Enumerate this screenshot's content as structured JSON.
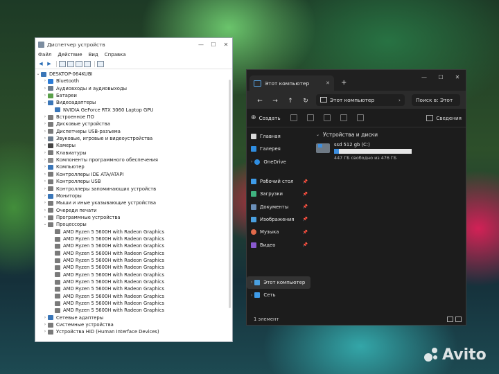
{
  "device_manager": {
    "title": "Диспетчер устройств",
    "menu": [
      "Файл",
      "Действие",
      "Вид",
      "Справка"
    ],
    "computer": "DESKTOP-064KUBI",
    "tree": [
      {
        "label": "Bluetooth",
        "color": "#2b7bd6",
        "expanded": false,
        "level": 1
      },
      {
        "label": "Аудиовходы и аудиовыходы",
        "color": "#6b7b8c",
        "expanded": false,
        "level": 1
      },
      {
        "label": "Батареи",
        "color": "#5aa04a",
        "expanded": false,
        "level": 1
      },
      {
        "label": "Видеоадаптеры",
        "color": "#3a76b8",
        "expanded": true,
        "level": 1
      },
      {
        "label": "NVIDIA GeForce RTX 3060 Laptop GPU",
        "color": "#3a76b8",
        "expanded": null,
        "level": 2
      },
      {
        "label": "Встроенное ПО",
        "color": "#7a7a7a",
        "expanded": false,
        "level": 1
      },
      {
        "label": "Дисковые устройства",
        "color": "#7a7a7a",
        "expanded": false,
        "level": 1
      },
      {
        "label": "Диспетчеры USB-разъема",
        "color": "#7a7a7a",
        "expanded": false,
        "level": 1
      },
      {
        "label": "Звуковые, игровые и видеоустройства",
        "color": "#6b7b8c",
        "expanded": false,
        "level": 1
      },
      {
        "label": "Камеры",
        "color": "#444444",
        "expanded": false,
        "level": 1
      },
      {
        "label": "Клавиатуры",
        "color": "#7a7a7a",
        "expanded": false,
        "level": 1
      },
      {
        "label": "Компоненты программного обеспечения",
        "color": "#8a8a8a",
        "expanded": false,
        "level": 1
      },
      {
        "label": "Компьютер",
        "color": "#3a76b8",
        "expanded": false,
        "level": 1
      },
      {
        "label": "Контроллеры IDE ATA/ATAPI",
        "color": "#7a7a7a",
        "expanded": false,
        "level": 1
      },
      {
        "label": "Контроллеры USB",
        "color": "#7a7a7a",
        "expanded": false,
        "level": 1
      },
      {
        "label": "Контроллеры запоминающих устройств",
        "color": "#7a7a7a",
        "expanded": false,
        "level": 1
      },
      {
        "label": "Мониторы",
        "color": "#3a76b8",
        "expanded": false,
        "level": 1
      },
      {
        "label": "Мыши и иные указывающие устройства",
        "color": "#7a7a7a",
        "expanded": false,
        "level": 1
      },
      {
        "label": "Очереди печати",
        "color": "#7a7a7a",
        "expanded": false,
        "level": 1
      },
      {
        "label": "Программные устройства",
        "color": "#7a7a7a",
        "expanded": false,
        "level": 1
      },
      {
        "label": "Процессоры",
        "color": "#7a7a7a",
        "expanded": true,
        "level": 1
      },
      {
        "label": "AMD Ryzen 5 5600H with Radeon Graphics",
        "color": "#7a7a7a",
        "expanded": null,
        "level": 2
      },
      {
        "label": "AMD Ryzen 5 5600H with Radeon Graphics",
        "color": "#7a7a7a",
        "expanded": null,
        "level": 2
      },
      {
        "label": "AMD Ryzen 5 5600H with Radeon Graphics",
        "color": "#7a7a7a",
        "expanded": null,
        "level": 2
      },
      {
        "label": "AMD Ryzen 5 5600H with Radeon Graphics",
        "color": "#7a7a7a",
        "expanded": null,
        "level": 2
      },
      {
        "label": "AMD Ryzen 5 5600H with Radeon Graphics",
        "color": "#7a7a7a",
        "expanded": null,
        "level": 2
      },
      {
        "label": "AMD Ryzen 5 5600H with Radeon Graphics",
        "color": "#7a7a7a",
        "expanded": null,
        "level": 2
      },
      {
        "label": "AMD Ryzen 5 5600H with Radeon Graphics",
        "color": "#7a7a7a",
        "expanded": null,
        "level": 2
      },
      {
        "label": "AMD Ryzen 5 5600H with Radeon Graphics",
        "color": "#7a7a7a",
        "expanded": null,
        "level": 2
      },
      {
        "label": "AMD Ryzen 5 5600H with Radeon Graphics",
        "color": "#7a7a7a",
        "expanded": null,
        "level": 2
      },
      {
        "label": "AMD Ryzen 5 5600H with Radeon Graphics",
        "color": "#7a7a7a",
        "expanded": null,
        "level": 2
      },
      {
        "label": "AMD Ryzen 5 5600H with Radeon Graphics",
        "color": "#7a7a7a",
        "expanded": null,
        "level": 2
      },
      {
        "label": "AMD Ryzen 5 5600H with Radeon Graphics",
        "color": "#7a7a7a",
        "expanded": null,
        "level": 2
      },
      {
        "label": "Сетевые адаптеры",
        "color": "#3a76b8",
        "expanded": false,
        "level": 1
      },
      {
        "label": "Системные устройства",
        "color": "#7a7a7a",
        "expanded": false,
        "level": 1
      },
      {
        "label": "Устройства HID (Human Interface Devices)",
        "color": "#7a7a7a",
        "expanded": false,
        "level": 1
      }
    ]
  },
  "explorer": {
    "tab_title": "Этот компьютер",
    "address": "Этот компьютер",
    "search_placeholder": "Поиск в: Этот",
    "create_label": "Создать",
    "details_label": "Сведения",
    "section_title": "Устройства и диски",
    "drive": {
      "name": "ssd 512 gb (C:)",
      "free_text": "447 ГБ свободно из 476 ГБ",
      "used_fraction": 0.06
    },
    "nav": {
      "home": "Главная",
      "gallery": "Галерея",
      "onedrive": "OneDrive",
      "desktop": "Рабочий стол",
      "downloads": "Загрузки",
      "documents": "Документы",
      "images": "Изображения",
      "music": "Музыка",
      "video": "Видео",
      "this_pc": "Этот компьютер",
      "network": "Сеть"
    },
    "status_text": "1 элемент"
  },
  "watermark": "Avito"
}
